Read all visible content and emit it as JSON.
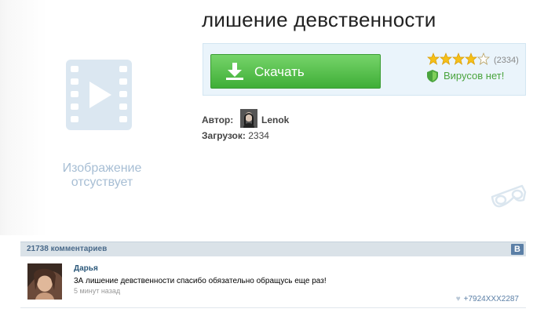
{
  "title": "лишение девственности",
  "placeholder": {
    "text": "Изображение отсуствует",
    "icon": "film-play-icon"
  },
  "download": {
    "button_label": "Скачать",
    "rating_stars": 4,
    "rating_max": 5,
    "rating_count": "(2334)",
    "virus_status": "Вирусов нет!"
  },
  "meta": {
    "author_label": "Автор:",
    "author_name": "Lenok",
    "downloads_label": "Загрузок:",
    "downloads_value": "2334"
  },
  "comments": {
    "count_text": "21738 комментариев",
    "badge": "B",
    "items": [
      {
        "author": "Дарья",
        "text": "3А лишение девственности спасибо обязательно обращусь еще раз!",
        "time": "5 минут назад",
        "like_text": "+7924XXX2287"
      }
    ]
  },
  "colors": {
    "accent_green": "#4aa43e",
    "link_blue": "#2b587a",
    "panel_blue": "#eaf4fb"
  }
}
